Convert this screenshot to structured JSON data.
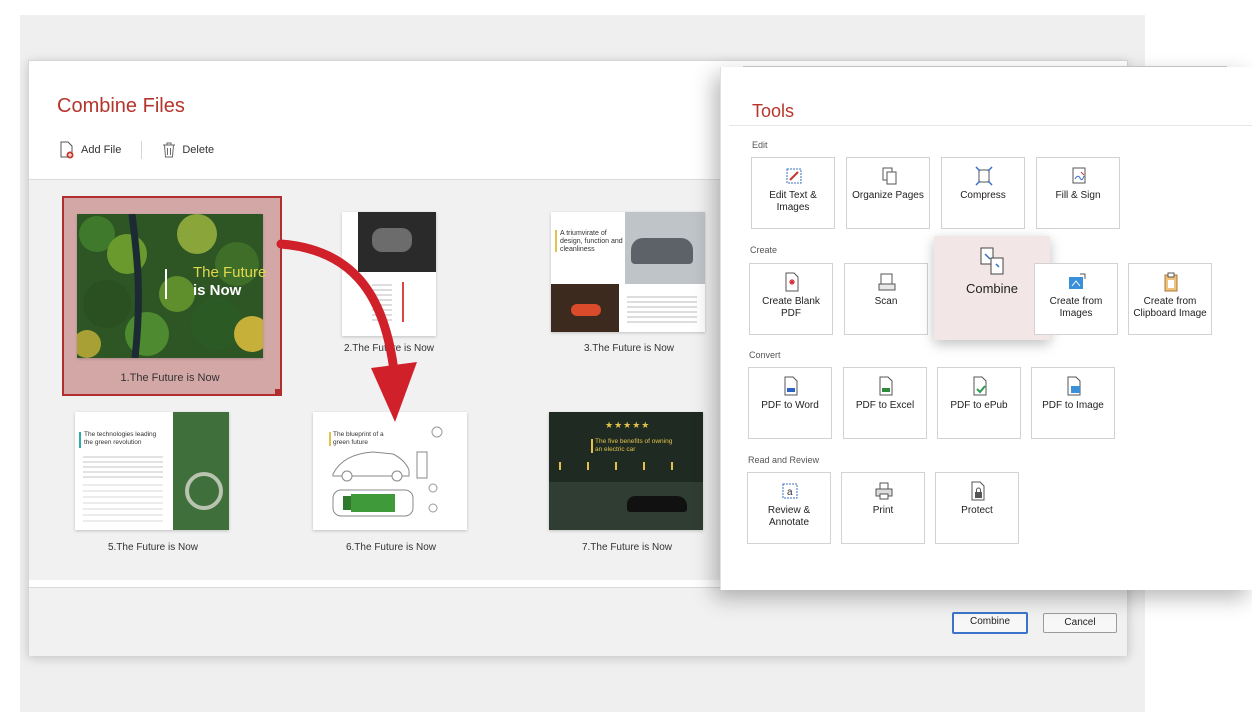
{
  "combine_window": {
    "title": "Combine Files",
    "add_file_label": "Add File",
    "delete_label": "Delete",
    "combine_button": "Combine",
    "cancel_button": "Cancel",
    "files": [
      {
        "caption": "1.The Future is Now",
        "cover_title_1": "The Future",
        "cover_title_2": "is Now"
      },
      {
        "caption": "2.The Future is Now"
      },
      {
        "caption": "3.The Future is Now",
        "page_text": "A triumvirate of design, function and cleanliness"
      },
      {
        "caption": "5.The Future is Now",
        "page_text": "The technologies leading the green revolution"
      },
      {
        "caption": "6.The Future is Now",
        "page_text": "The blueprint of a green future"
      },
      {
        "caption": "7.The Future is Now",
        "page_text": "The five benefits of owning an electric car"
      }
    ]
  },
  "tools": {
    "title": "Tools",
    "sections": {
      "edit": "Edit",
      "create": "Create",
      "convert": "Convert",
      "read": "Read and Review"
    },
    "edit_items": [
      "Edit Text & Images",
      "Organize Pages",
      "Compress",
      "Fill & Sign"
    ],
    "create_items": [
      "Create Blank PDF",
      "Scan",
      "Combine",
      "Create from Images",
      "Create from Clipboard Image"
    ],
    "convert_items": [
      "PDF to Word",
      "PDF to Excel",
      "PDF to ePub",
      "PDF to Image"
    ],
    "read_items": [
      "Review & Annotate",
      "Print",
      "Protect"
    ]
  },
  "colors": {
    "accent": "#b5352c",
    "arrow": "#d0202a",
    "selection": "#b12e2e"
  }
}
